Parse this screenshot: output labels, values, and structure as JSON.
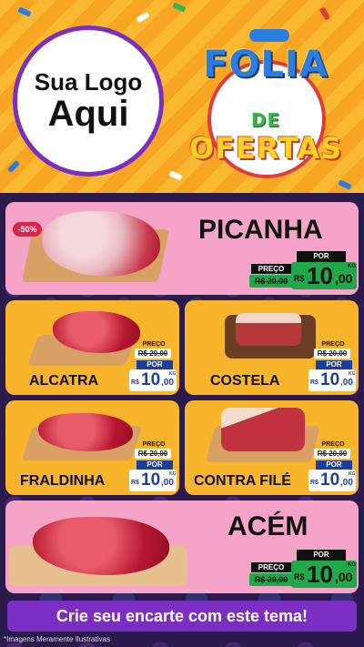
{
  "header": {
    "logo_line1": "Sua Logo",
    "logo_line2": "Aqui",
    "theme_title_1": "FOLIA",
    "theme_title_2": "DE",
    "theme_title_3": "OFERTAS"
  },
  "products": [
    {
      "name": "PICANHA",
      "discount": "-50%",
      "label_price": "PREÇO",
      "old_price": "R$ 20,00",
      "label_por": "POR",
      "currency": "R$",
      "new_price_int": "10",
      "new_price_dec": ",00",
      "unit": "KG"
    },
    {
      "name": "ALCATRA",
      "label_price": "PREÇO",
      "old_price": "R$ 20,00",
      "label_por": "POR",
      "currency": "R$",
      "new_price_int": "10",
      "new_price_dec": ",00",
      "unit": "KG"
    },
    {
      "name": "COSTELA",
      "label_price": "PREÇO",
      "old_price": "R$ 20,00",
      "label_por": "POR",
      "currency": "R$",
      "new_price_int": "10",
      "new_price_dec": ",00",
      "unit": "KG"
    },
    {
      "name": "FRALDINHA",
      "label_price": "PREÇO",
      "old_price": "R$ 20,00",
      "label_por": "POR",
      "currency": "R$",
      "new_price_int": "10",
      "new_price_dec": ",00",
      "unit": "KG"
    },
    {
      "name": "CONTRA FILÉ",
      "label_price": "PREÇO",
      "old_price": "R$ 20,00",
      "label_por": "POR",
      "currency": "R$",
      "new_price_int": "10",
      "new_price_dec": ",00",
      "unit": "KG"
    },
    {
      "name": "ACÉM",
      "label_price": "PREÇO",
      "old_price": "R$ 20,00",
      "label_por": "POR",
      "currency": "R$",
      "new_price_int": "10",
      "new_price_dec": ",00",
      "unit": "KG"
    }
  ],
  "cta": {
    "label": "Crie seu encarte com este tema!"
  },
  "footer": {
    "note": "*Imagens Meramente Ilustrativas"
  },
  "colors": {
    "purple": "#7a2fc2",
    "pink_card": "#f5a3c7",
    "orange_card": "#f8b42a",
    "price_green": "#22a84a",
    "price_black": "#111111"
  }
}
